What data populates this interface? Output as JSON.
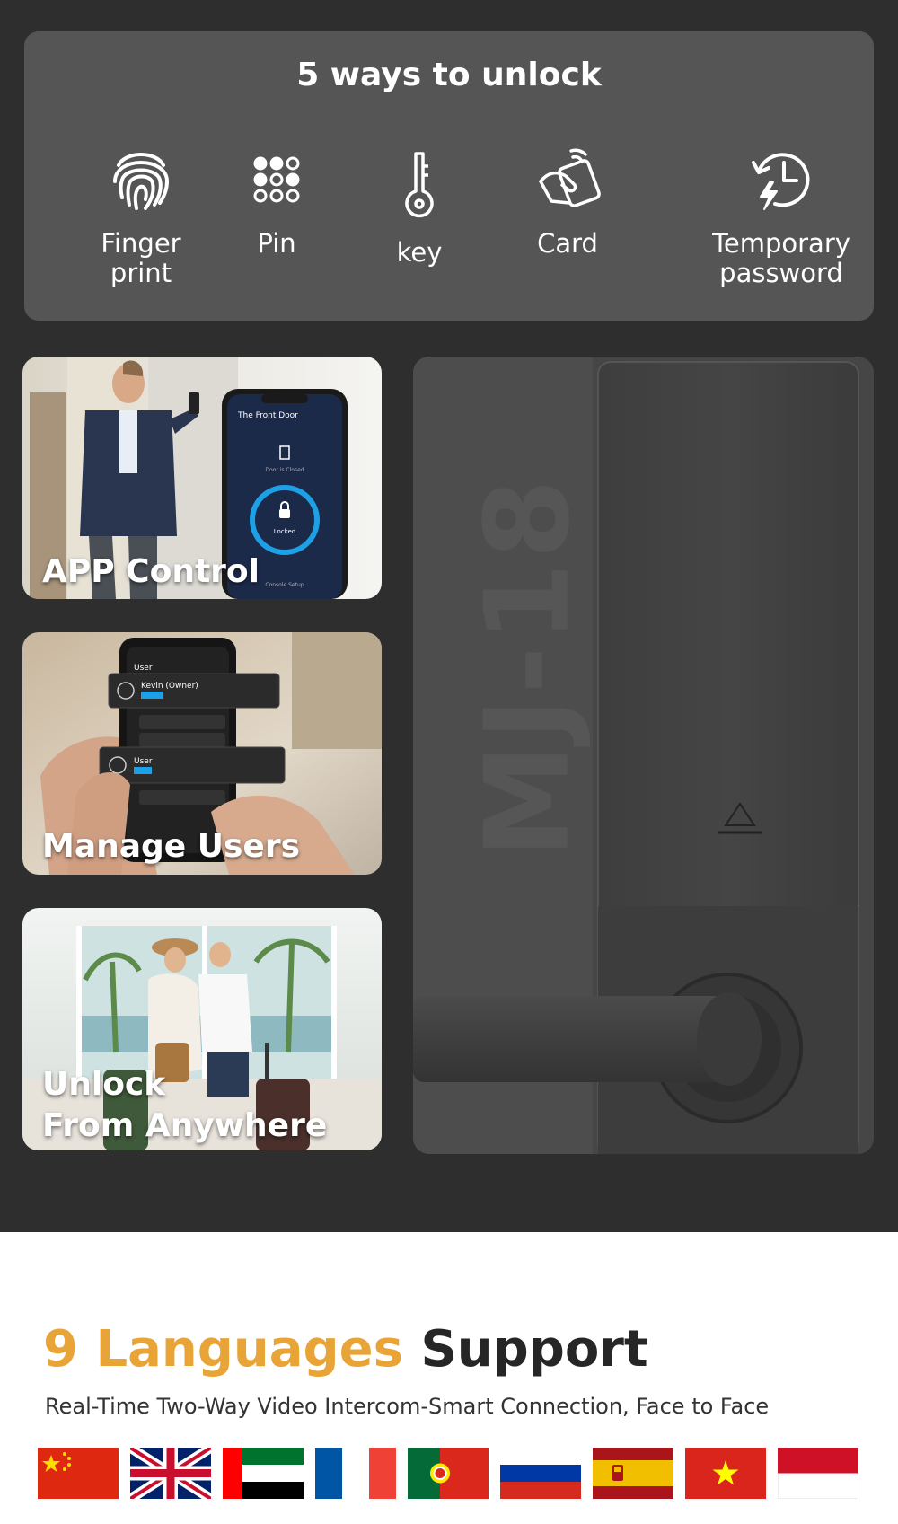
{
  "unlock": {
    "title": "5 ways to unlock",
    "methods": [
      {
        "label": "Finger\nprint",
        "icon": "fingerprint-icon"
      },
      {
        "label": "Pin",
        "icon": "keypad-icon"
      },
      {
        "label": "key",
        "icon": "key-icon"
      },
      {
        "label": "Card",
        "icon": "card-icon"
      },
      {
        "label": "Temporary\npassword",
        "icon": "clock-password-icon"
      }
    ]
  },
  "features": [
    {
      "label": "APP Control"
    },
    {
      "label": "Manage Users"
    },
    {
      "label": "Unlock\nFrom Anywhere"
    }
  ],
  "app_screen": {
    "title": "The Front Door",
    "status": "Door is Closed",
    "lock_state": "Locked",
    "footer": "Console Setup"
  },
  "users_screen": {
    "header": "User",
    "owner": "Kevin (Owner)",
    "user": "User"
  },
  "lock": {
    "model": "MJ-18"
  },
  "languages": {
    "title_accent": "9 Languages",
    "title_rest": "Support",
    "subtitle": "Real-Time Two-Way Video Intercom-Smart Connection, Face to Face",
    "flags": [
      "china-flag",
      "uk-flag",
      "uae-flag",
      "france-flag",
      "portugal-flag",
      "russia-flag",
      "spain-flag",
      "vietnam-flag",
      "indonesia-flag"
    ]
  },
  "colors": {
    "accent": "#e8a437",
    "panel_dark": "#2f2e2e",
    "panel_gray": "#555555"
  }
}
